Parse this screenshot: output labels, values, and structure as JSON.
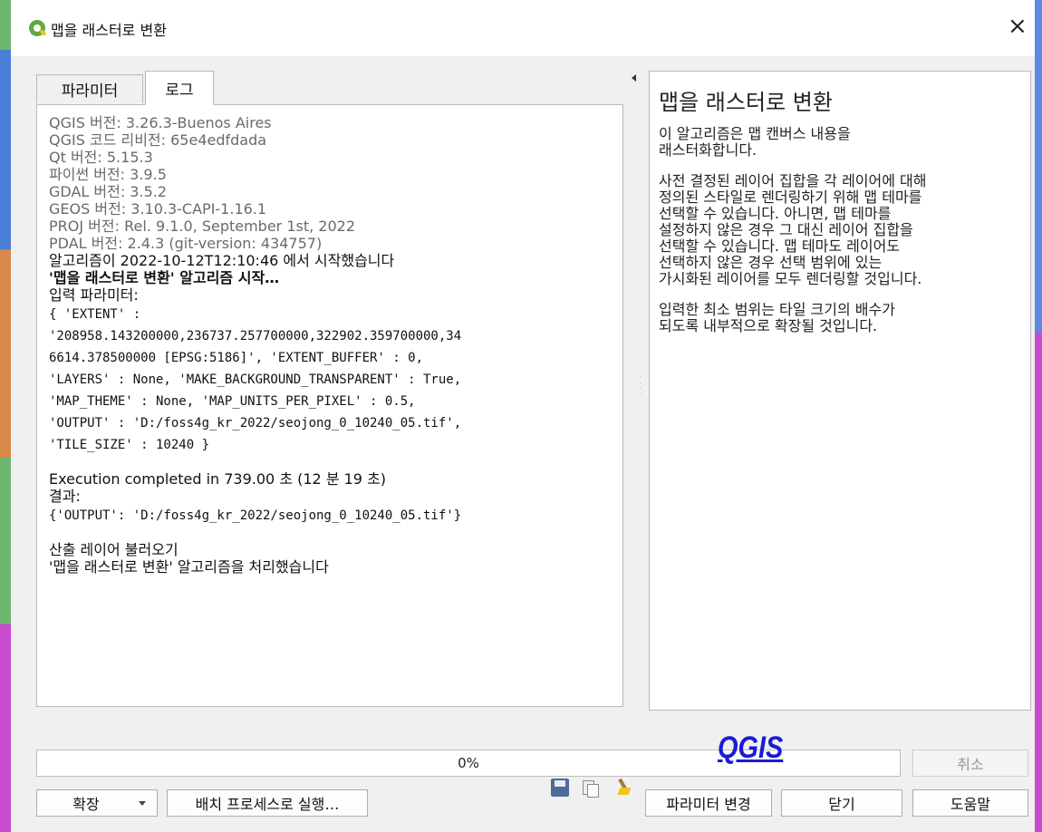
{
  "window": {
    "title": "맵을 래스터로 변환",
    "close_label": "×"
  },
  "tabs": [
    {
      "label": "파라미터"
    },
    {
      "label": "로그"
    }
  ],
  "log": {
    "info_lines": [
      "QGIS 버전: 3.26.3-Buenos Aires",
      "QGIS 코드 리비전: 65e4edfdada",
      "Qt 버전: 5.15.3",
      "파이썬 버전: 3.9.5",
      "GDAL 버전: 3.5.2",
      "GEOS 버전: 3.10.3-CAPI-1.16.1",
      "PROJ 버전: Rel. 9.1.0, September 1st, 2022",
      "PDAL 버전: 2.4.3 (git-version: 434757)"
    ],
    "start_line": "알고리즘이 2022-10-12T12:10:46 에서 시작했습니다",
    "algo_start": "'맵을 래스터로 변환' 알고리즘 시작…",
    "input_params_label": "입력 파라미터:",
    "params_lines": [
      "{ 'EXTENT' :",
      "'208958.143200000,236737.257700000,322902.359700000,34",
      "6614.378500000 [EPSG:5186]', 'EXTENT_BUFFER' : 0,",
      "'LAYERS' : None, 'MAKE_BACKGROUND_TRANSPARENT' : True,",
      "'MAP_THEME' : None, 'MAP_UNITS_PER_PIXEL' : 0.5,",
      "'OUTPUT' : 'D:/foss4g_kr_2022/seojong_0_10240_05.tif',",
      "'TILE_SIZE' : 10240 }"
    ],
    "execution_line": "Execution completed in 739.00 초 (12 분 19 초)",
    "result_label": "결과:",
    "result_value": "{'OUTPUT': 'D:/foss4g_kr_2022/seojong_0_10240_05.tif'}",
    "loading_line": "산출 레이어 불러오기",
    "done_line": "'맵을 래스터로 변환' 알고리즘을 처리했습니다"
  },
  "help": {
    "title": "맵을 래스터로 변환",
    "paragraphs": [
      [
        "이 알고리즘은 맵 캔버스 내용을",
        "래스터화합니다."
      ],
      [
        "사전 결정된 레이어 집합을 각 레이어에 대해",
        "정의된 스타일로 렌더링하기 위해 맵 테마를",
        "선택할 수 있습니다. 아니면, 맵 테마를",
        "설정하지 않은 경우 그 대신 레이어 집합을",
        "선택할 수 있습니다. 맵 테마도 레이어도",
        "선택하지 않은 경우 선택 범위에 있는",
        "가시화된 레이어를 모두 렌더링할 것입니다."
      ],
      [
        "입력한 최소 범위는 타일 크기의 배수가",
        "되도록 내부적으로 확장될 것입니다."
      ]
    ]
  },
  "progress": {
    "value": 0,
    "label": "0%"
  },
  "watermark": "QGIS",
  "buttons": {
    "cancel": "취소",
    "expand": "확장",
    "batch": "배치 프로세스로 실행…",
    "change_params": "파라미터 변경",
    "close": "닫기",
    "help": "도움말"
  },
  "icons": [
    "qgis-logo-icon",
    "save-icon",
    "copy-icon",
    "clear-icon",
    "chevron-down-icon",
    "collapse-arrow-icon"
  ]
}
